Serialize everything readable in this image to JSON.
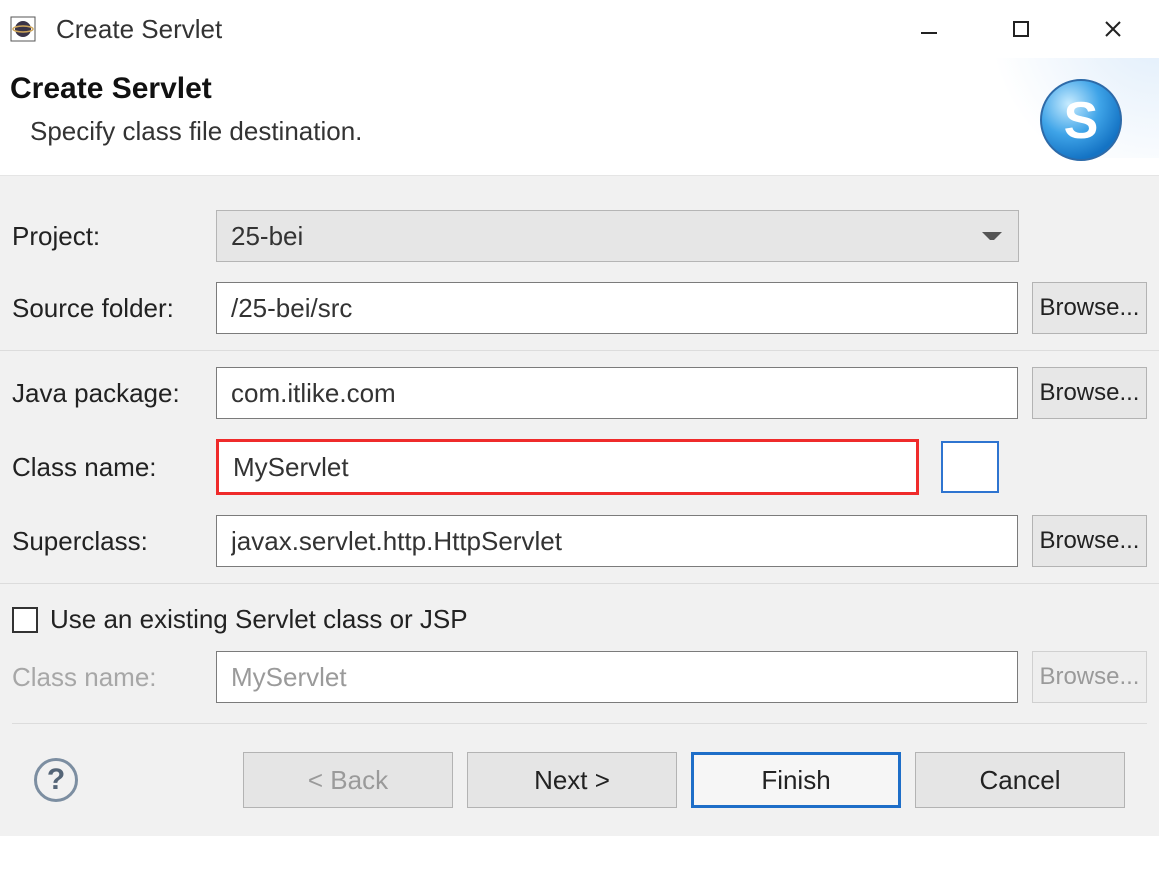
{
  "titlebar": {
    "title": "Create Servlet"
  },
  "banner": {
    "heading": "Create Servlet",
    "subtitle": "Specify class file destination."
  },
  "group1": {
    "project_label": "Project:",
    "project_value": "25-bei",
    "source_folder_label": "Source folder:",
    "source_folder_value": "/25-bei/src",
    "browse_label": "Browse..."
  },
  "group2": {
    "java_package_label": "Java package:",
    "java_package_value": "com.itlike.com",
    "class_name_label": "Class name:",
    "class_name_value": "MyServlet",
    "superclass_label": "Superclass:",
    "superclass_value": "javax.servlet.http.HttpServlet",
    "browse_label": "Browse..."
  },
  "existing": {
    "checkbox_label": "Use an existing Servlet class or JSP",
    "class_name_label": "Class name:",
    "class_name_value": "MyServlet",
    "browse_label": "Browse..."
  },
  "footer": {
    "back_label": "< Back",
    "next_label": "Next >",
    "finish_label": "Finish",
    "cancel_label": "Cancel"
  }
}
